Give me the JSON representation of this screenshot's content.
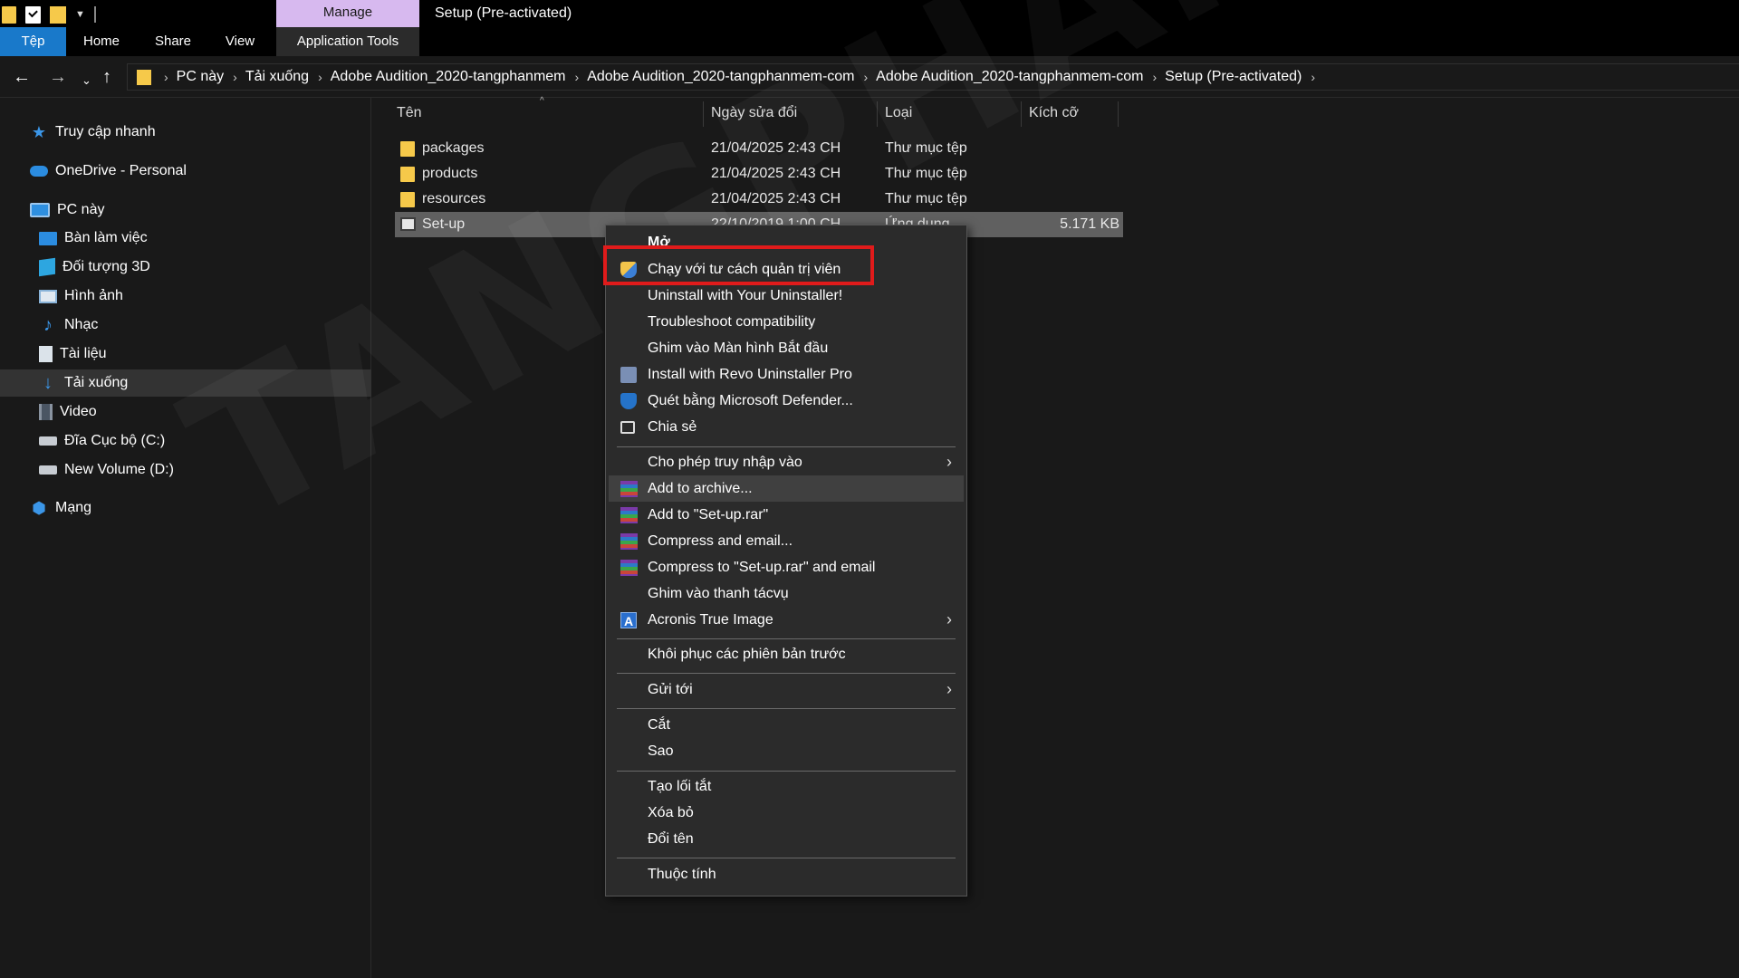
{
  "window": {
    "manage_tab": "Manage",
    "title": "Setup (Pre-activated)"
  },
  "ribbon": {
    "tabs": [
      "Tệp",
      "Home",
      "Share",
      "View",
      "Application Tools"
    ]
  },
  "address": {
    "crumbs": [
      "PC này",
      "Tải xuống",
      "Adobe Audition_2020-tangphanmem",
      "Adobe Audition_2020-tangphanmem-com",
      "Adobe Audition_2020-tangphanmem-com",
      "Setup (Pre-activated)"
    ]
  },
  "sidebar": {
    "items": [
      {
        "label": "Truy cập nhanh",
        "icon": "star-icon"
      },
      {
        "label": "OneDrive - Personal",
        "icon": "cloud-icon"
      },
      {
        "label": "PC này",
        "icon": "computer-icon"
      },
      {
        "label": "Bàn làm việc",
        "icon": "desktop-icon"
      },
      {
        "label": "Đối tượng 3D",
        "icon": "cube-3d-icon"
      },
      {
        "label": "Hình ảnh",
        "icon": "pictures-icon"
      },
      {
        "label": "Nhạc",
        "icon": "music-icon"
      },
      {
        "label": "Tài liệu",
        "icon": "documents-icon"
      },
      {
        "label": "Tải xuống",
        "icon": "download-icon"
      },
      {
        "label": "Video",
        "icon": "video-icon"
      },
      {
        "label": "Đĩa Cục bộ (C:)",
        "icon": "drive-icon"
      },
      {
        "label": "New Volume (D:)",
        "icon": "drive-icon"
      },
      {
        "label": "Mạng",
        "icon": "network-icon"
      }
    ]
  },
  "file_list": {
    "columns": [
      "Tên",
      "Ngày sửa đổi",
      "Loại",
      "Kích cỡ"
    ],
    "rows": [
      {
        "name": "packages",
        "date": "21/04/2025 2:43 CH",
        "type": "Thư mục tệp",
        "size": ""
      },
      {
        "name": "products",
        "date": "21/04/2025 2:43 CH",
        "type": "Thư mục tệp",
        "size": ""
      },
      {
        "name": "resources",
        "date": "21/04/2025 2:43 CH",
        "type": "Thư mục tệp",
        "size": ""
      },
      {
        "name": "Set-up",
        "date": "22/10/2019 1:00 CH",
        "type": "Ứng dụng",
        "size": "5.171 KB"
      }
    ]
  },
  "context_menu": {
    "items": [
      "Mở",
      "Chạy với tư cách quản trị viên",
      "Uninstall with Your Uninstaller!",
      "Troubleshoot compatibility",
      "Ghim vào Màn hình Bắt đầu",
      "Install with Revo Uninstaller Pro",
      "Quét bằng Microsoft Defender...",
      "Chia sẻ",
      "Cho phép truy nhập vào",
      "Add to archive...",
      "Add to \"Set-up.rar\"",
      "Compress and email...",
      "Compress to \"Set-up.rar\" and email",
      "Ghim vào thanh tácvụ",
      "Acronis True Image",
      "Khôi phục các phiên bản trước",
      "Gửi tới",
      "Cắt",
      "Sao",
      "Tạo lối tắt",
      "Xóa bỏ",
      "Đổi tên",
      "Thuộc tính"
    ],
    "highlighted_color": "#e01b1b"
  },
  "watermark": "TANGPHANMEM"
}
